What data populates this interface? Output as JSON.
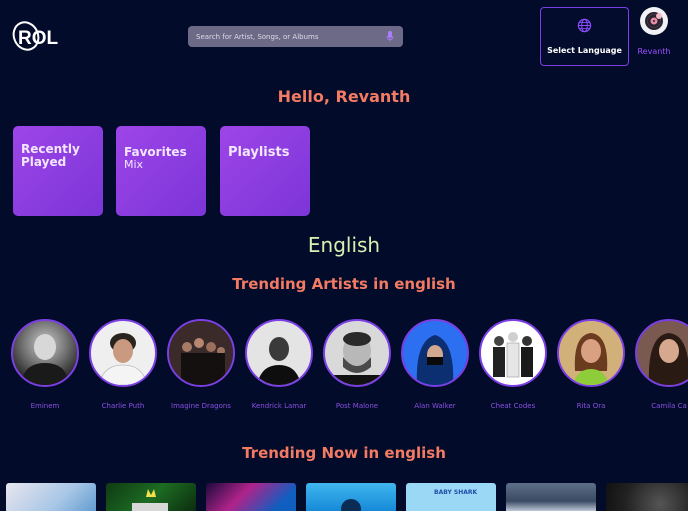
{
  "header": {
    "logo_text": "ROL",
    "search_placeholder": "Search for Artist, Songs, or Albums",
    "language_button": "Select Language",
    "user_name": "Revanth"
  },
  "greeting": "Hello, Revanth",
  "quick_links": [
    {
      "line1": "Recently",
      "line2": "Played"
    },
    {
      "line1": "Favorites",
      "line2": "Mix"
    },
    {
      "line1": "Playlists",
      "line2": ""
    }
  ],
  "language": "English",
  "trending_artists_title": "Trending Artists in english",
  "artists": [
    {
      "name": "Eminem"
    },
    {
      "name": "Charlie Puth"
    },
    {
      "name": "Imagine Dragons"
    },
    {
      "name": "Kendrick Lamar"
    },
    {
      "name": "Post Malone"
    },
    {
      "name": "Alan Walker"
    },
    {
      "name": "Cheat Codes"
    },
    {
      "name": "Rita Ora"
    },
    {
      "name": "Camila Ca"
    }
  ],
  "trending_now_title": "Trending Now in english",
  "tiles": [
    {
      "name": "album-1",
      "tag": ""
    },
    {
      "name": "album-2",
      "tag": ""
    },
    {
      "name": "album-3",
      "tag": ""
    },
    {
      "name": "album-4",
      "tag": ""
    },
    {
      "name": "album-5",
      "tag": "BABY SHARK"
    },
    {
      "name": "album-6",
      "tag": ""
    },
    {
      "name": "album-7",
      "tag": ""
    }
  ],
  "colors": {
    "background": "#020b2a",
    "accent_purple": "#7b3fe4",
    "heading_coral": "#f47b63",
    "language_green": "#d9f0b0"
  },
  "icons": {
    "mic": "mic-icon",
    "globe": "globe-icon",
    "avatar": "vinyl-avatar-icon"
  }
}
